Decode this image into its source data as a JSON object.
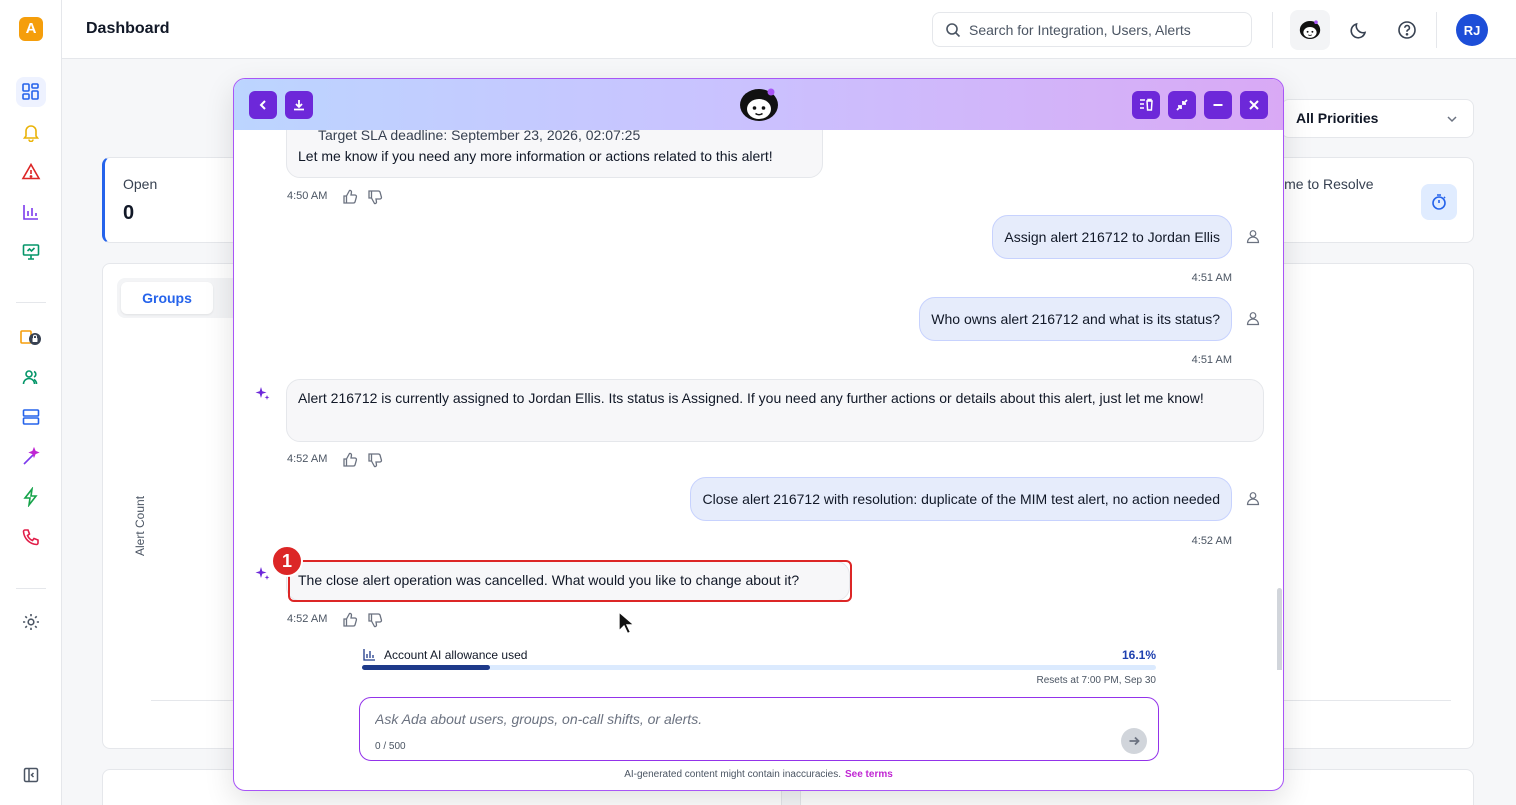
{
  "header": {
    "title": "Dashboard",
    "search_placeholder": "Search for Integration, Users, Alerts",
    "user_initials": "RJ"
  },
  "dashboard": {
    "priority_filter": "All Priorities",
    "open_label": "Open",
    "open_value": "0",
    "time_to_resolve_label": "ime to Resolve",
    "tab_groups": "Groups",
    "y_axis_label": "Alert Count"
  },
  "chat": {
    "messages": [
      {
        "role": "bot",
        "text_top": "Target SLA deadline: September 23, 2026, 02:07:25",
        "text": "Let me know if you need any more information or actions related to this alert!",
        "time": "4:50 AM"
      },
      {
        "role": "user",
        "text": "Assign alert 216712 to Jordan Ellis",
        "time": "4:51 AM"
      },
      {
        "role": "user",
        "text": "Who owns alert 216712 and what is its status?",
        "time": "4:51 AM"
      },
      {
        "role": "bot",
        "text": "Alert 216712 is currently assigned to Jordan Ellis. Its status is Assigned. If you need any further actions or details about this alert, just let me know!",
        "time": "4:52 AM"
      },
      {
        "role": "user",
        "text": "Close alert 216712 with resolution: duplicate of the MIM test alert, no action needed",
        "time": "4:52 AM"
      },
      {
        "role": "bot",
        "text": "The close alert operation was cancelled. What would you like to change about it?",
        "time": "4:52 AM"
      }
    ],
    "annotation_number": "1",
    "allowance": {
      "label": "Account AI allowance used",
      "percent_text": "16.1%",
      "percent": 16.1,
      "reset_text": "Resets at 7:00 PM, Sep 30"
    },
    "input_placeholder": "Ask Ada about users, groups, on-call shifts, or alerts.",
    "char_count": "0 / 500",
    "disclaimer": "AI-generated content might contain inaccuracies.",
    "see_terms": "See terms"
  },
  "colors": {
    "accent_purple": "#6d28d9",
    "brand_blue": "#2563eb",
    "highlight_red": "#dc2626"
  }
}
